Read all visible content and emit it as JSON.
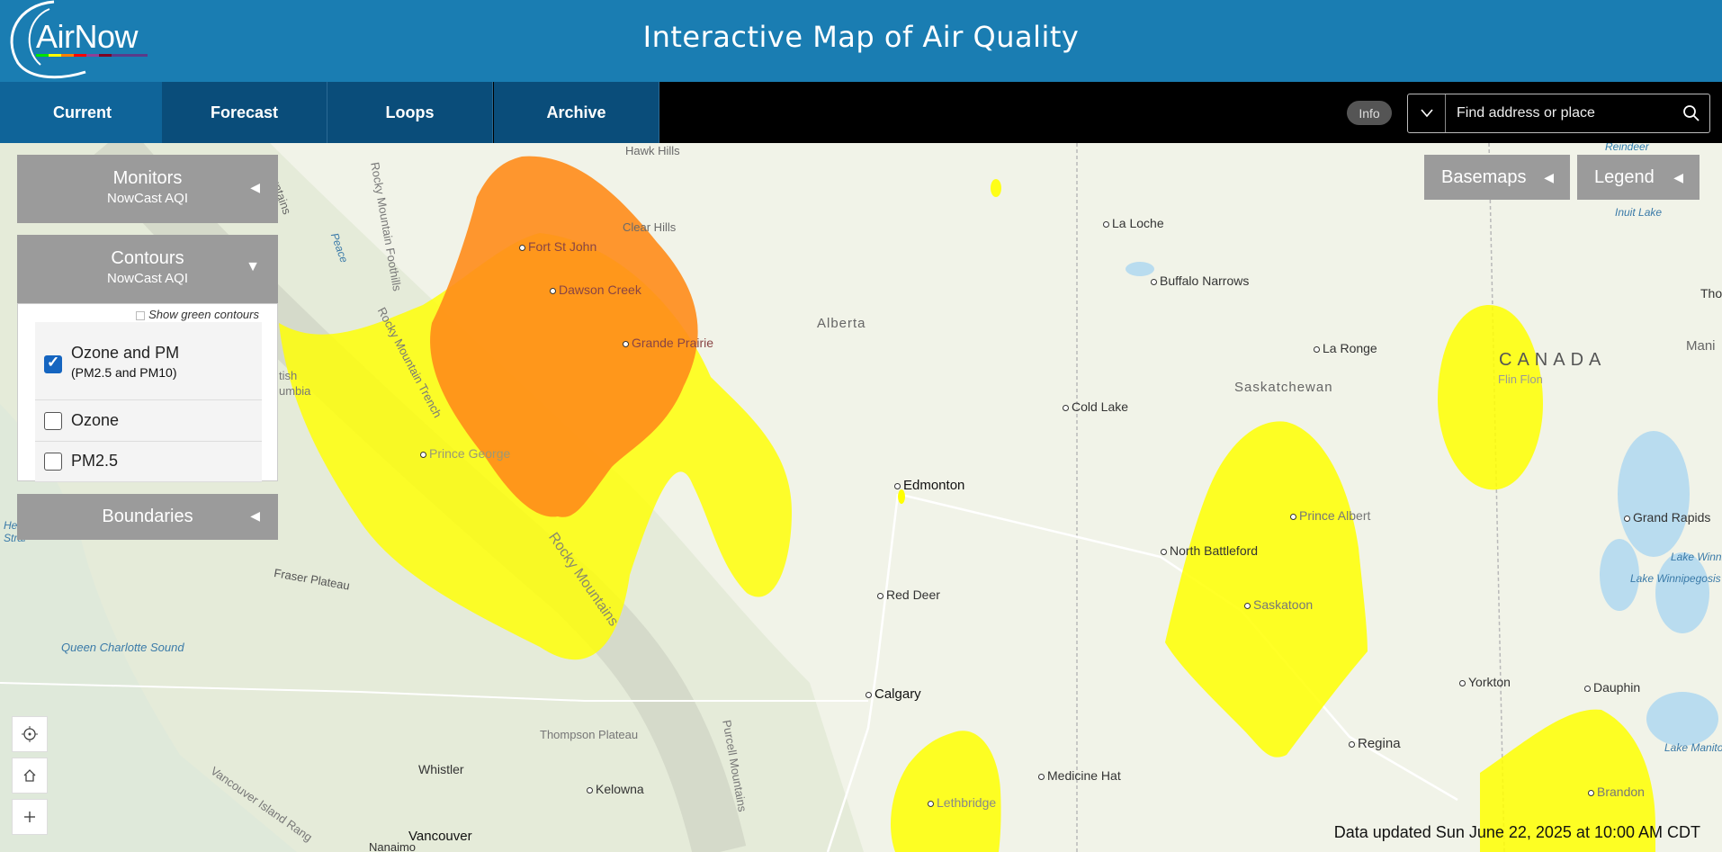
{
  "header": {
    "logo_text": "AirNow",
    "title": "Interactive Map of Air Quality"
  },
  "nav": {
    "tabs": [
      "Current",
      "Forecast",
      "Loops",
      "Archive"
    ],
    "active": "Current",
    "info_label": "Info",
    "search_placeholder": "Find address or place"
  },
  "panels": {
    "monitors": {
      "title": "Monitors",
      "subtitle": "NowCast AQI"
    },
    "contours": {
      "title": "Contours",
      "subtitle": "NowCast AQI",
      "show_green_label": "Show green contours",
      "options": [
        {
          "label": "Ozone and PM",
          "sub": "(PM2.5 and PM10)",
          "checked": true
        },
        {
          "label": "Ozone",
          "sub": "",
          "checked": false
        },
        {
          "label": "PM2.5",
          "sub": "",
          "checked": false
        }
      ]
    },
    "boundaries": {
      "title": "Boundaries"
    }
  },
  "map_buttons": {
    "basemaps": "Basemaps",
    "legend": "Legend"
  },
  "map": {
    "country": "CANADA",
    "regions": [
      "Alberta",
      "Saskatchewan"
    ],
    "cities": [
      "La Loche",
      "Buffalo Narrows",
      "La Ronge",
      "Flin Flon",
      "Cold Lake",
      "Edmonton",
      "North Battleford",
      "Prince Albert",
      "Saskatoon",
      "Red Deer",
      "Calgary",
      "Medicine Hat",
      "Regina",
      "Yorkton",
      "Dauphin",
      "Brandon",
      "Grand Rapids",
      "Lethbridge",
      "Kelowna",
      "Whistler",
      "Vancouver",
      "Nanaimo",
      "Fort St John",
      "Dawson Creek",
      "Grande Prairie",
      "Prince George",
      "Clear Hills",
      "Hawk Hills",
      "Reindeer",
      "Tho",
      "Mani"
    ],
    "features": [
      "Rocky Mountain Foothills",
      "Rocky Mountain Trench",
      "Rocky Mountains",
      "Fraser Plateau",
      "Queen Charlotte Sound",
      "Thompson Plateau",
      "Purcell Mountains",
      "Vancouver Island Rang",
      "Lake Winnipegosis",
      "Lake Winnipeg",
      "Lake Manitoba",
      "Inuit Lake",
      "Peace",
      "ountains",
      "tish umbia",
      "Hei Strai"
    ],
    "aqi_colors": {
      "moderate": "#ffff00",
      "usg": "#ff7e00"
    }
  },
  "tools": [
    "locate-icon",
    "home-icon",
    "zoom-in-icon"
  ],
  "status": {
    "updated": "Data updated Sun June 22, 2025 at 10:00 AM CDT"
  }
}
